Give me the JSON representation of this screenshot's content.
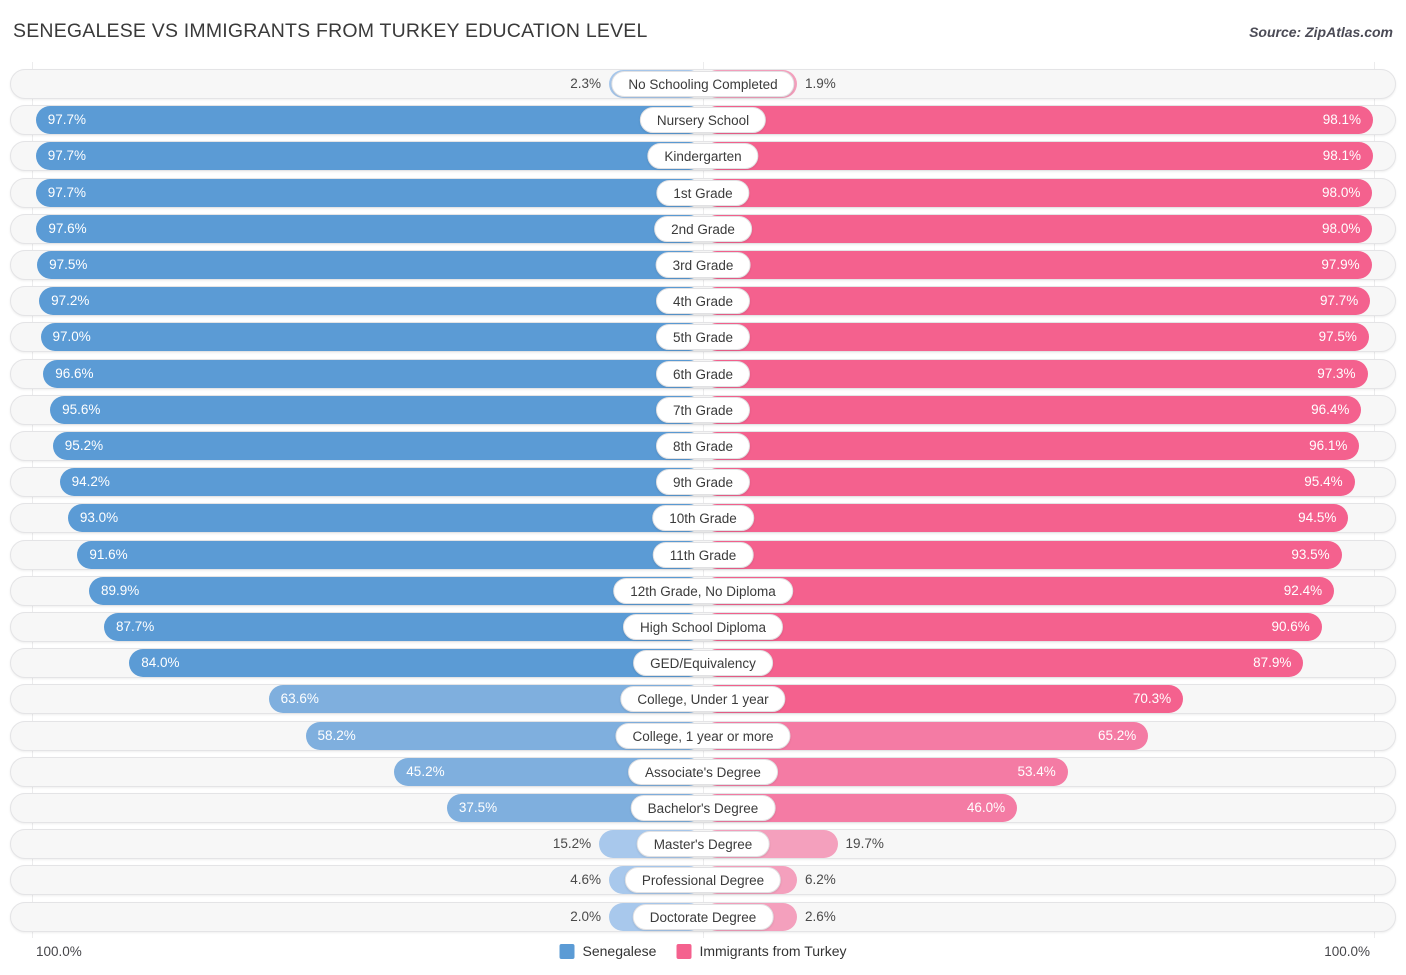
{
  "header": {
    "title": "SENEGALESE VS IMMIGRANTS FROM TURKEY EDUCATION LEVEL",
    "source": "Source: ZipAtlas.com"
  },
  "axis": {
    "left": "100.0%",
    "right": "100.0%"
  },
  "legend": [
    {
      "label": "Senegalese",
      "color": "#5B9BD5"
    },
    {
      "label": "Immigrants from Turkey",
      "color": "#F4618E"
    }
  ],
  "colors": {
    "blue_strong": "#5B9BD5",
    "blue_mid": "#7FAFDE",
    "blue_light": "#A8C8EC",
    "pink_strong": "#F4618E",
    "pink_mid": "#F47BA4",
    "pink_light": "#F4A0BD",
    "track": "#f7f7f7",
    "track_border": "#e4e4e6"
  },
  "chart_data": {
    "type": "bar",
    "title": "SENEGALESE VS IMMIGRANTS FROM TURKEY EDUCATION LEVEL",
    "subtitle": "",
    "xlabel": "",
    "ylabel": "",
    "orientation": "horizontal-diverging",
    "xlim": [
      0,
      100
    ],
    "grid": false,
    "legend_position": "bottom-center",
    "categories": [
      "No Schooling Completed",
      "Nursery School",
      "Kindergarten",
      "1st Grade",
      "2nd Grade",
      "3rd Grade",
      "4th Grade",
      "5th Grade",
      "6th Grade",
      "7th Grade",
      "8th Grade",
      "9th Grade",
      "10th Grade",
      "11th Grade",
      "12th Grade, No Diploma",
      "High School Diploma",
      "GED/Equivalency",
      "College, Under 1 year",
      "College, 1 year or more",
      "Associate's Degree",
      "Bachelor's Degree",
      "Master's Degree",
      "Professional Degree",
      "Doctorate Degree"
    ],
    "series": [
      {
        "name": "Senegalese",
        "side": "left",
        "color": "#5B9BD5",
        "values": [
          2.3,
          97.7,
          97.7,
          97.7,
          97.6,
          97.5,
          97.2,
          97.0,
          96.6,
          95.6,
          95.2,
          94.2,
          93.0,
          91.6,
          89.9,
          87.7,
          84.0,
          63.6,
          58.2,
          45.2,
          37.5,
          15.2,
          4.6,
          2.0
        ],
        "labels": [
          "2.3%",
          "97.7%",
          "97.7%",
          "97.7%",
          "97.6%",
          "97.5%",
          "97.2%",
          "97.0%",
          "96.6%",
          "95.6%",
          "95.2%",
          "94.2%",
          "93.0%",
          "91.6%",
          "89.9%",
          "87.7%",
          "84.0%",
          "63.6%",
          "58.2%",
          "45.2%",
          "37.5%",
          "15.2%",
          "4.6%",
          "2.0%"
        ]
      },
      {
        "name": "Immigrants from Turkey",
        "side": "right",
        "color": "#F4618E",
        "values": [
          1.9,
          98.1,
          98.1,
          98.0,
          98.0,
          97.9,
          97.7,
          97.5,
          97.3,
          96.4,
          96.1,
          95.4,
          94.5,
          93.5,
          92.4,
          90.6,
          87.9,
          70.3,
          65.2,
          53.4,
          46.0,
          19.7,
          6.2,
          2.6
        ],
        "labels": [
          "1.9%",
          "98.1%",
          "98.1%",
          "98.0%",
          "98.0%",
          "97.9%",
          "97.7%",
          "97.5%",
          "97.3%",
          "96.4%",
          "96.1%",
          "95.4%",
          "94.5%",
          "93.5%",
          "92.4%",
          "90.6%",
          "87.9%",
          "70.3%",
          "65.2%",
          "53.4%",
          "46.0%",
          "19.7%",
          "6.2%",
          "2.6%"
        ]
      }
    ]
  }
}
